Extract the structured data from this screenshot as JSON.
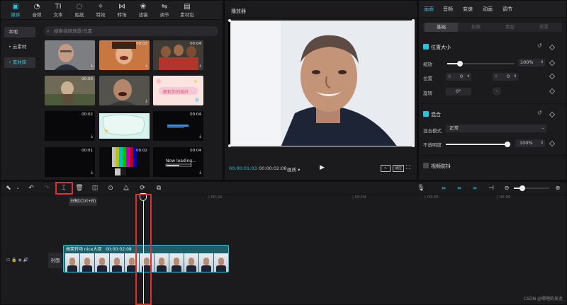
{
  "media_toolbar": {
    "tabs": [
      {
        "icon": "media-icon",
        "label": "媒体"
      },
      {
        "icon": "audio-icon",
        "label": "音频"
      },
      {
        "icon": "text-icon",
        "label": "文本"
      },
      {
        "icon": "sticker-icon",
        "label": "贴纸"
      },
      {
        "icon": "effects-icon",
        "label": "特效"
      },
      {
        "icon": "transition-icon",
        "label": "转场"
      },
      {
        "icon": "filter-icon",
        "label": "滤镜"
      },
      {
        "icon": "adjust-icon",
        "label": "调节"
      },
      {
        "icon": "package-icon",
        "label": "素材包"
      }
    ]
  },
  "left_nav": {
    "items": [
      {
        "label": "本地"
      },
      {
        "label": "• 云素材"
      },
      {
        "label": "• 素材库"
      }
    ]
  },
  "search": {
    "placeholder": "搜索视频场景/元素"
  },
  "thumbnails": [
    {
      "duration": "",
      "kind": "photo-man-glasses"
    },
    {
      "duration": "00:03",
      "kind": "photo-laughing"
    },
    {
      "duration": "00:04",
      "kind": "photo-group"
    },
    {
      "duration": "00:06",
      "kind": "photo-cartoon"
    },
    {
      "duration": "",
      "kind": "photo-laughing-man"
    },
    {
      "duration": "00:05",
      "kind": "pink-banner",
      "text": "面對你的美好"
    },
    {
      "duration": "00:02",
      "kind": "black"
    },
    {
      "duration": "",
      "kind": "blue-bubble"
    },
    {
      "duration": "00:04",
      "kind": "progress-bar"
    },
    {
      "duration": "00:01",
      "kind": "black"
    },
    {
      "duration": "00:02",
      "kind": "color-bars"
    },
    {
      "duration": "00:04",
      "kind": "loading",
      "text": "Now loading..."
    }
  ],
  "player": {
    "title": "播放器",
    "current_time": "00:00:01:03",
    "total_time": "00:00:02:08",
    "quality": "画质",
    "ratio_label": "适应",
    "play_icon": "play-icon"
  },
  "props": {
    "tabs": [
      "画面",
      "音频",
      "变速",
      "动画",
      "调节"
    ],
    "subtabs": [
      "基础",
      "抠像",
      "蒙版",
      "背景"
    ],
    "position_size": {
      "title": "位置大小",
      "scale_label": "缩放",
      "scale_value": "100%",
      "scale_fraction": 0.19,
      "position_label": "位置",
      "x_label": "X",
      "x_value": "0",
      "y_label": "Y",
      "y_value": "0",
      "rotate_label": "旋转",
      "rotate_value": "0°"
    },
    "blend": {
      "title": "混合",
      "mode_label": "混合模式",
      "mode_value": "正常",
      "opacity_label": "不透明度",
      "opacity_value": "100%",
      "opacity_fraction": 1.0
    },
    "stabilize": {
      "title": "视频防抖"
    }
  },
  "timeline": {
    "ticks": [
      "| 00:02",
      "| 00:04",
      "| 00:05",
      "| 00:06"
    ],
    "tooltip": "分割(Ctrl+B)",
    "clip_title": "搞笑转场 nice大叔",
    "clip_duration": "00:00:02:08",
    "cover_label": "封面"
  },
  "watermark": "CSDN @嗯哩的吴龙",
  "colors": {
    "accent": "#2ec2d6",
    "highlight": "#e0302a"
  }
}
